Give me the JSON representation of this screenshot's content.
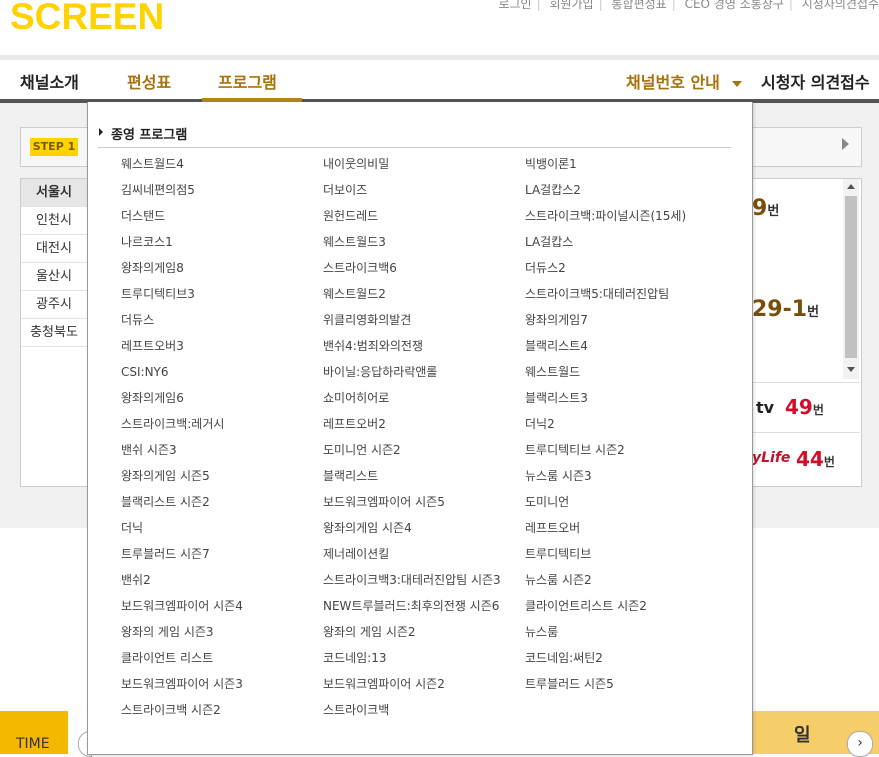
{
  "logo": "SCREEN",
  "util_links": [
    "로그인",
    "회원가입",
    "통합편성표",
    "CEO 경영 소통창구",
    "시청자의견접수"
  ],
  "nav": {
    "items": [
      "채널소개",
      "편성표",
      "프로그램"
    ],
    "right": {
      "channel_guide": "채널번호 안내",
      "viewer_opinion": "시청자 의견접수"
    }
  },
  "background": {
    "step_label": "STEP 1",
    "regions": [
      "서울시",
      "인천시",
      "대전시",
      "울산시",
      "광주시",
      "충청북도"
    ],
    "channel_numbers": [
      {
        "value": "9",
        "unit": "번"
      },
      {
        "value": "29-1",
        "unit": "번"
      }
    ],
    "channel_rows": [
      {
        "logo": "tv",
        "number": "49",
        "unit": "번"
      },
      {
        "logo": "yLife",
        "number": "44",
        "unit": "번"
      }
    ],
    "time_label": "TIME",
    "day_label": "일"
  },
  "dropdown": {
    "title": "종영 프로그램",
    "programs": [
      "웨스트월드4",
      "내이웃의비밀",
      "빅뱅이론1",
      "김씨네편의점5",
      "더보이즈",
      "LA걸캅스2",
      "더스탠드",
      "원헌드레드",
      "스트라이크백:파이널시즌(15세)",
      "나르코스1",
      "웨스트월드3",
      "LA걸캅스",
      "왕좌의게임8",
      "스트라이크백6",
      "더듀스2",
      "트루디텍티브3",
      "웨스트월드2",
      "스트라이크백5:대테러진압팀",
      "더듀스",
      "위클리영화의발견",
      "왕좌의게임7",
      "레프트오버3",
      "밴쉬4:범죄와의전쟁",
      "블랙리스트4",
      "CSI:NY6",
      "바이닐:응답하라락앤롤",
      "웨스트월드",
      "왕좌의게임6",
      "쇼미어히어로",
      "블랙리스트3",
      "스트라이크백:레거시",
      "레프트오버2",
      "더닉2",
      "밴쉬 시즌3",
      "도미니언 시즌2",
      "트루디텍티브 시즌2",
      "왕좌의게임 시즌5",
      "블랙리스트",
      "뉴스룸 시즌3",
      "블랙리스트 시즌2",
      "보드워크엠파이어 시즌5",
      "도미니언",
      "더닉",
      "왕좌의게임 시즌4",
      "레프트오버",
      "트루블러드 시즌7",
      "제너레이션킬",
      "트루디텍티브",
      "밴쉬2",
      "스트라이크백3:대테러진압팀 시즌3",
      "뉴스룸 시즌2",
      "보드워크엠파이어 시즌4",
      "NEW트루블러드:최후의전쟁 시즌6",
      "클라이언트리스트 시즌2",
      "왕좌의 게임 시즌3",
      "왕좌의 게임 시즌2",
      "뉴스룸",
      "클라이언트 리스트",
      "코드네임:13",
      "코드네임:써틴2",
      "보드워크엠파이어 시즌3",
      "보드워크엠파이어 시즌2",
      "트루블러드 시즌5",
      "스트라이크백 시즌2",
      "스트라이크백"
    ]
  },
  "colors": {
    "brand_yellow": "#ffd200",
    "nav_gold": "#a8720c",
    "active_bar": "#b28516",
    "channel_red": "#d0102a"
  }
}
